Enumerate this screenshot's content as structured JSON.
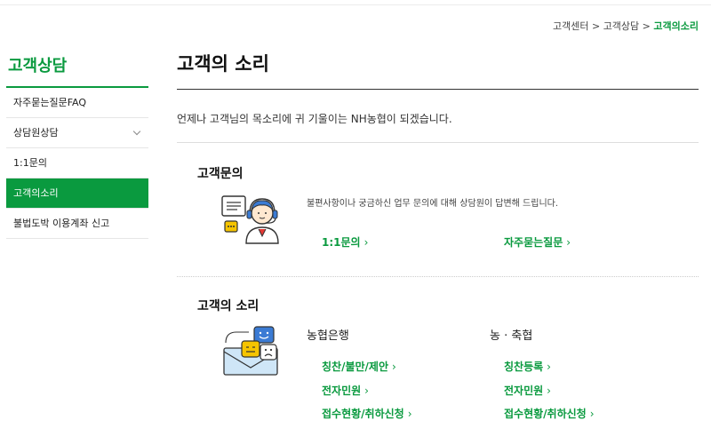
{
  "breadcrumb": {
    "items": [
      "고객센터",
      "고객상담"
    ],
    "sep": ">",
    "current": "고객의소리"
  },
  "sidebar": {
    "title": "고객상담",
    "items": [
      {
        "label": "자주묻는질문FAQ"
      },
      {
        "label": "상담원상담"
      },
      {
        "label": "1:1문의"
      },
      {
        "label": "고객의소리"
      },
      {
        "label": "불법도박 이용계좌 신고"
      }
    ]
  },
  "main": {
    "title": "고객의 소리",
    "intro": "언제나 고객님의 목소리에 귀 기울이는 NH농협이 되겠습니다.",
    "inquiry": {
      "title": "고객문의",
      "desc": "불편사항이나 궁금하신 업무 문의에 대해 상담원이 답변해 드립니다.",
      "links": [
        "1:1문의",
        "자주묻는질문"
      ]
    },
    "voice": {
      "title": "고객의 소리",
      "bank": {
        "title": "농협은행",
        "links": [
          "칭찬/불만/제안",
          "전자민원",
          "접수현황/취하신청"
        ]
      },
      "coop": {
        "title": "농 · 축협",
        "links": [
          "칭찬등록",
          "전자민원",
          "접수현황/취하신청"
        ]
      }
    }
  },
  "colors": {
    "accent": "#0a9a3f"
  },
  "icons": {
    "link_arrow": "›",
    "agent": "headset-agent-icon",
    "voice": "speech-bubbles-icon"
  }
}
